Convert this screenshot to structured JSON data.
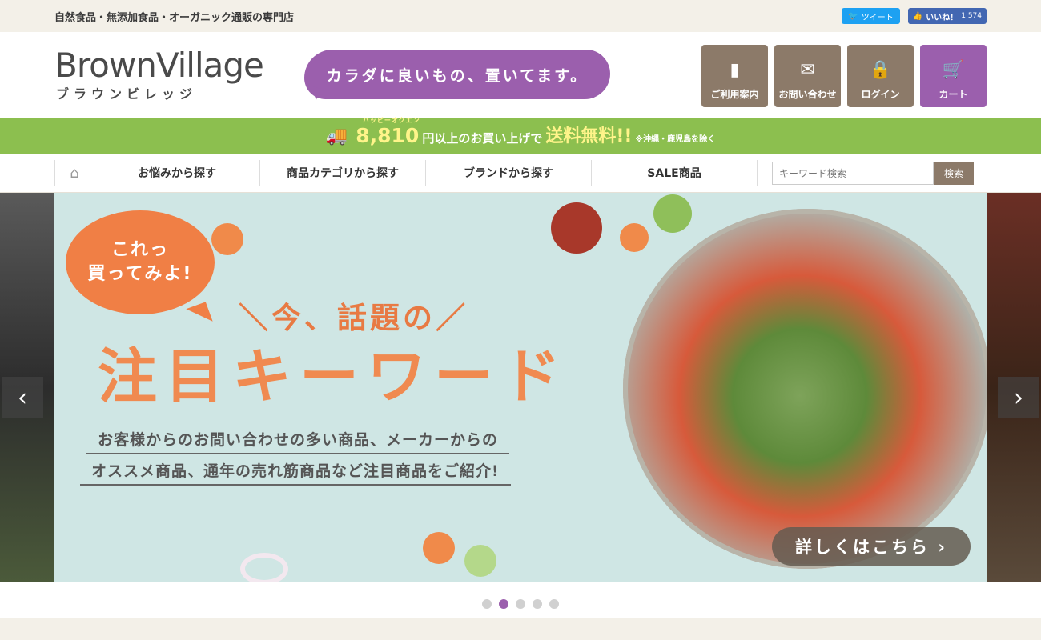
{
  "topbar": {
    "tagline": "自然食品・無添加食品・オーガニック通販の専門店",
    "tweet_label": "ツイート",
    "like_label": "いいね！",
    "like_count": "1,574"
  },
  "header": {
    "logo_main": "BrownVillage",
    "logo_sub": "ブラウンビレッジ",
    "catchcopy": "カラダに良いもの、置いてます。",
    "buttons": [
      {
        "label": "ご利用案内",
        "icon": "guide-icon"
      },
      {
        "label": "お問い合わせ",
        "icon": "mail-icon"
      },
      {
        "label": "ログイン",
        "icon": "lock-icon"
      },
      {
        "label": "カート",
        "icon": "cart-icon"
      }
    ]
  },
  "shipping": {
    "ruby": "ハッピーオクエン",
    "amount": "8,810",
    "text1": "円以上のお買い上げで",
    "free": "送料無料!!",
    "note": "※沖縄・鹿児島を除く"
  },
  "nav": {
    "items": [
      "お悩みから探す",
      "商品カテゴリから探す",
      "ブランドから探す",
      "SALE商品"
    ],
    "search_placeholder": "キーワード検索",
    "search_button": "検索"
  },
  "hero": {
    "bubble_line1": "これっ",
    "bubble_line2": "買ってみよ!",
    "subheading": "＼今、話題の／",
    "heading": "注目キーワード",
    "desc1": "お客様からのお問い合わせの多い商品、メーカーからの",
    "desc2": "オススメ商品、通年の売れ筋商品など注目商品をご紹介!",
    "more_button": "詳しくはこちら ›",
    "prev_arrow": "‹",
    "next_arrow": "›"
  },
  "slider": {
    "total_slides": 5,
    "active_slide": 2
  },
  "colors": {
    "accent_purple": "#9b5fad",
    "brown": "#8c7a69",
    "green_bar": "#8cbf4f",
    "orange": "#f08a50"
  }
}
